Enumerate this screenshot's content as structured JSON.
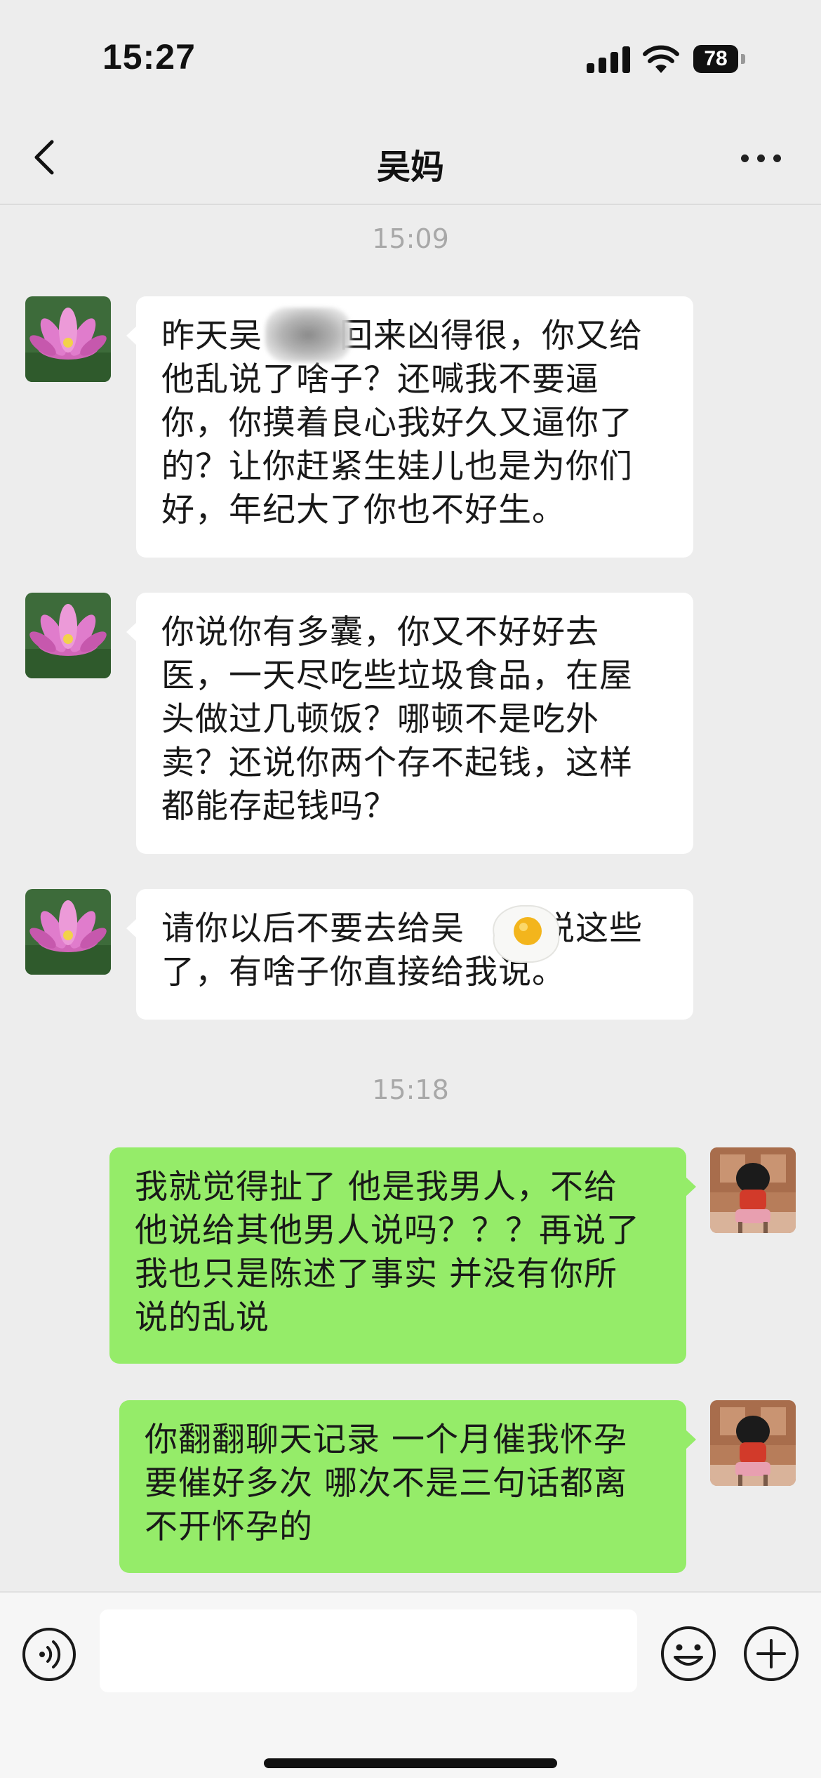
{
  "status_bar": {
    "time": "15:27",
    "battery": "78"
  },
  "header": {
    "title": "吴妈"
  },
  "messages": [
    {
      "type": "timestamp",
      "text": "15:09"
    },
    {
      "type": "incoming",
      "lines": [
        "昨天吴",
        "回来凶得很，你又给",
        "他乱说了啥子？还喊我不要逼",
        "你，你摸着良心我好久又逼你了",
        "的？让你赶紧生娃儿也是为你们",
        "好，年纪大了你也不好生。"
      ]
    },
    {
      "type": "incoming",
      "lines": [
        "你说你有多囊，你又不好好去",
        "医，一天尽吃些垃圾食品，在屋",
        "头做过几顿饭？哪顿不是吃外",
        "卖？还说你两个存不起钱，这样",
        "都能存起钱吗？"
      ]
    },
    {
      "type": "incoming",
      "lines": [
        "请你以后不要去给吴",
        "说这些",
        "了，有啥子你直接给我说。"
      ]
    },
    {
      "type": "timestamp",
      "text": "15:18"
    },
    {
      "type": "outgoing",
      "lines": [
        "我就觉得扯了 他是我男人，不给",
        "他说给其他男人说吗？？？再说了",
        "我也只是陈述了事实 并没有你所",
        "说的乱说"
      ]
    },
    {
      "type": "outgoing",
      "lines": [
        "你翻翻聊天记录 一个月催我怀孕",
        "要催好多次 哪次不是三句话都离",
        "不开怀孕的"
      ]
    }
  ],
  "icons": {
    "back": "chevron-left-icon",
    "more": "more-dots-icon",
    "voice": "voice-icon",
    "emoji": "emoji-icon",
    "plus": "plus-icon"
  },
  "colors": {
    "background": "#ededed",
    "incoming_bubble": "#ffffff",
    "outgoing_bubble": "#95ec69",
    "timestamp": "#a8a8a8"
  }
}
